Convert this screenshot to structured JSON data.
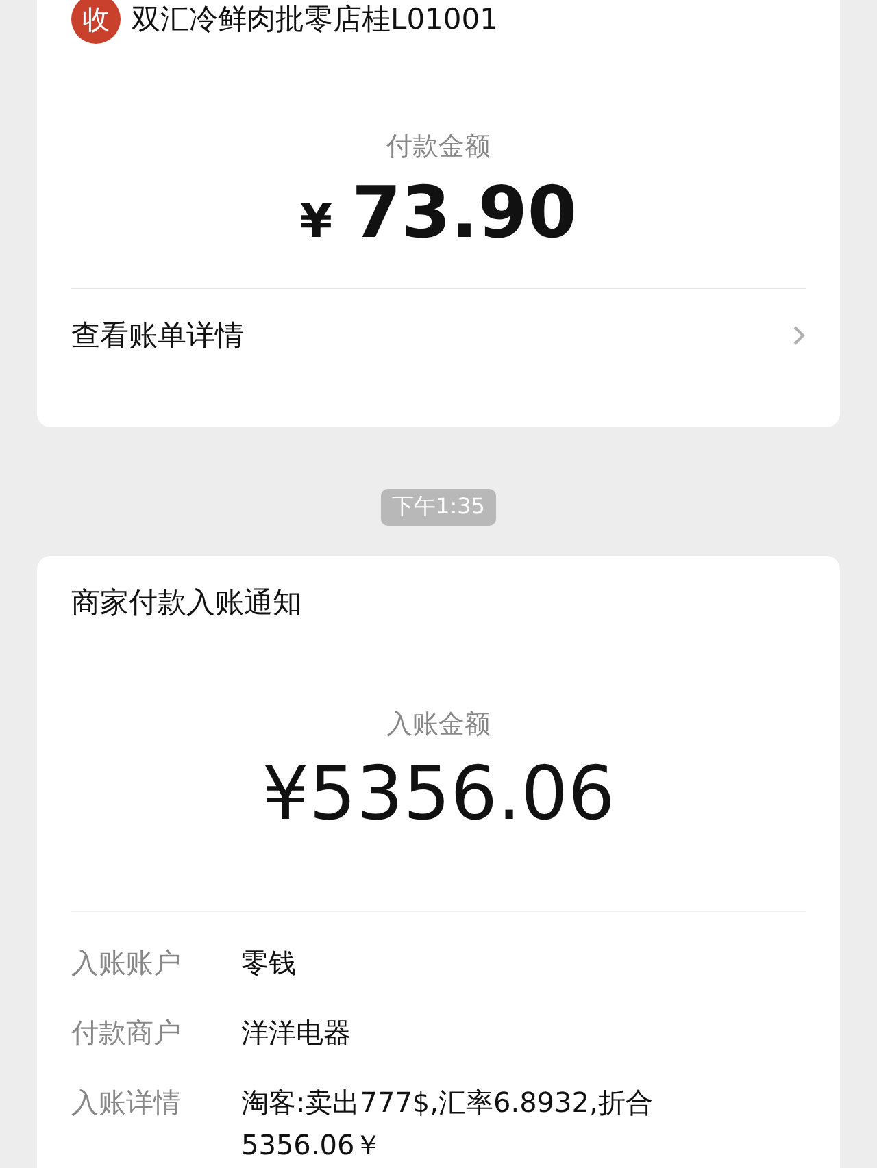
{
  "payment_card": {
    "merchant_icon": "收",
    "merchant": "双汇冷鲜肉批零店桂L01001",
    "amount_label": "付款金额",
    "currency": "¥",
    "amount": "73.90",
    "link": "查看账单详情"
  },
  "time": "下午1:35",
  "notice_card": {
    "title": "商家付款入账通知",
    "amount_label": "入账金额",
    "amount": "¥5356.06",
    "rows": [
      {
        "label": "入账账户",
        "value": "零钱"
      },
      {
        "label": "付款商户",
        "value": "洋洋电器"
      },
      {
        "label": "入账详情",
        "value": "淘客:卖出777$,汇率6.8932,折合5356.06￥"
      }
    ]
  }
}
